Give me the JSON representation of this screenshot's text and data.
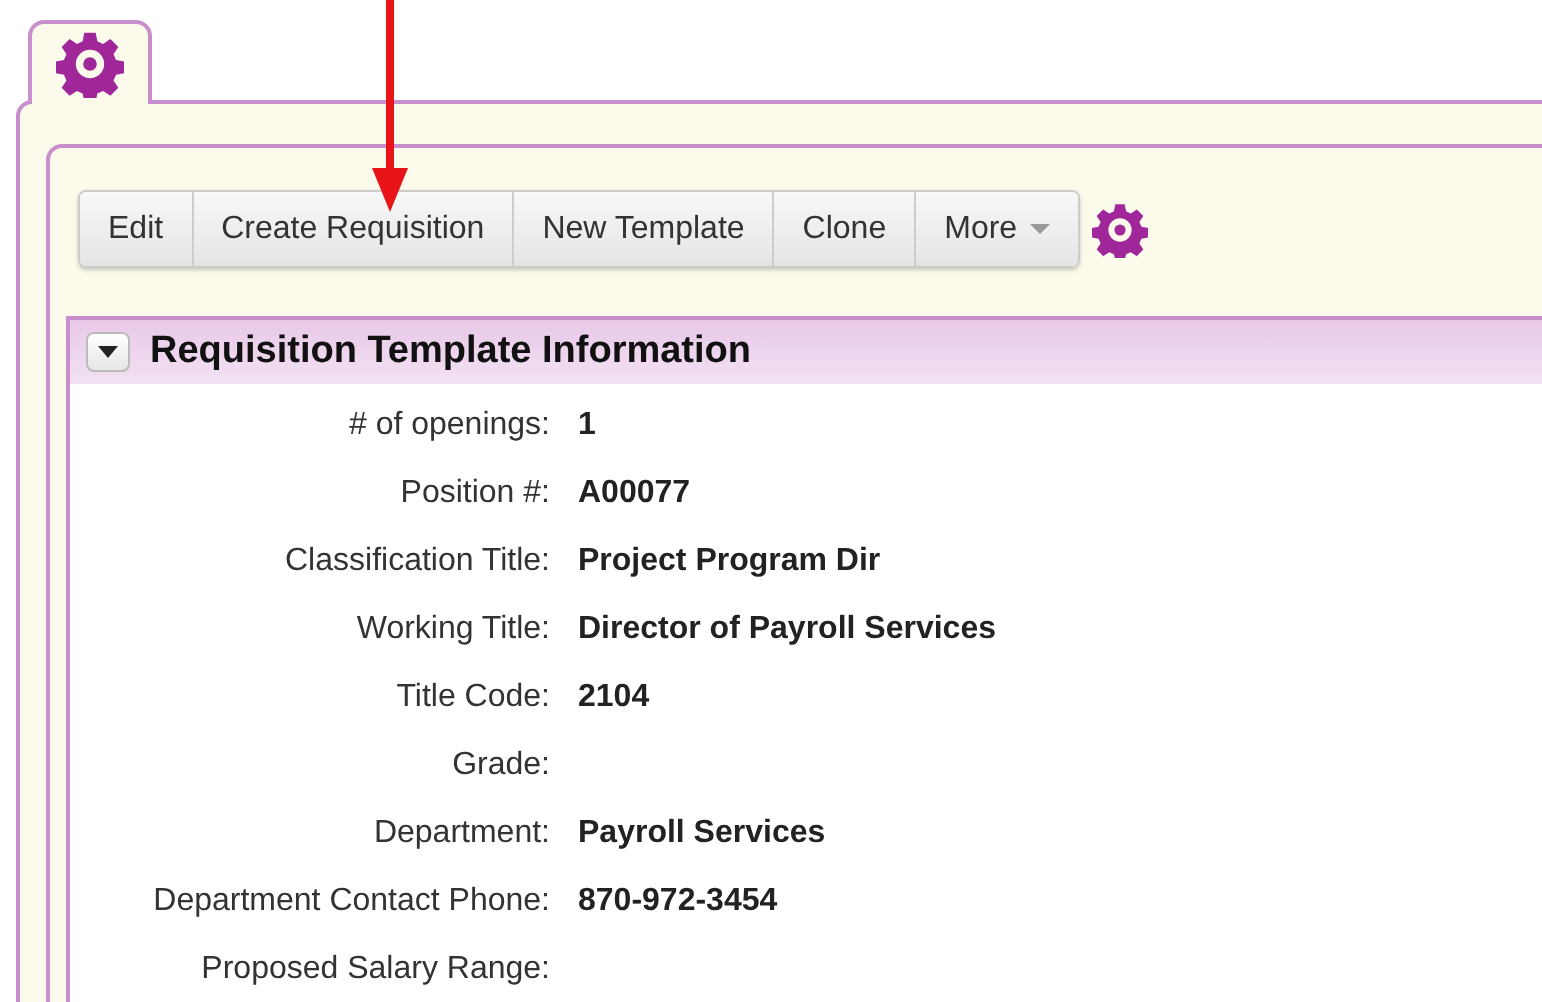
{
  "toolbar": {
    "buttons": [
      {
        "label": "Edit",
        "kind": "plain"
      },
      {
        "label": "Create Requisition",
        "kind": "plain"
      },
      {
        "label": "New Template",
        "kind": "plain"
      },
      {
        "label": "Clone",
        "kind": "plain"
      },
      {
        "label": "More",
        "kind": "dropdown"
      }
    ]
  },
  "section": {
    "title": "Requisition Template Information",
    "expanded": true,
    "fields": [
      {
        "label": "# of openings:",
        "value": "1"
      },
      {
        "label": "Position #:",
        "value": "A00077"
      },
      {
        "label": "Classification Title:",
        "value": "Project Program Dir"
      },
      {
        "label": "Working Title:",
        "value": "Director of Payroll Services"
      },
      {
        "label": "Title Code:",
        "value": "2104"
      },
      {
        "label": "Grade:"
      },
      {
        "label": "Department:",
        "value": "Payroll Services"
      },
      {
        "label": "Department Contact Phone:",
        "value": "870-972-3454"
      },
      {
        "label": "Proposed Salary Range:"
      }
    ]
  }
}
